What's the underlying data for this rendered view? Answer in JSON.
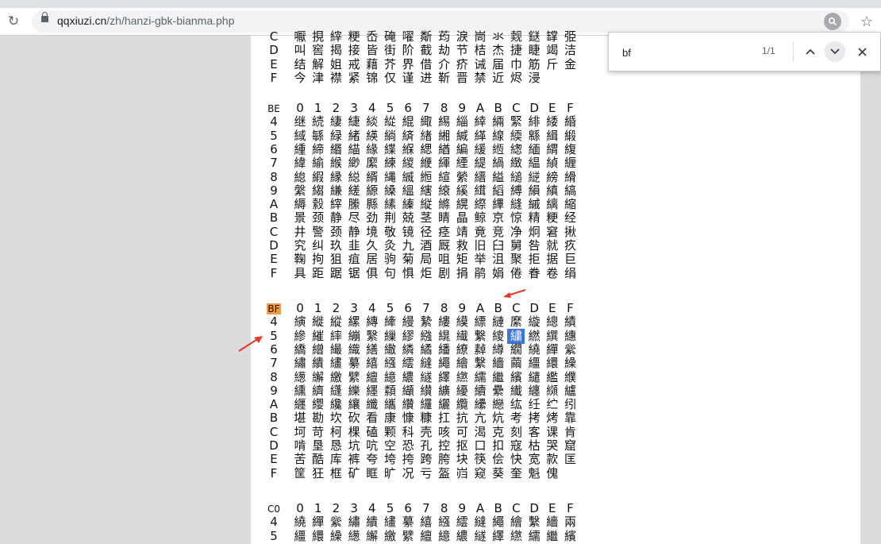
{
  "browser": {
    "url_host": "qqxiuzi.cn",
    "url_path": "/zh/hanzi-gbk-bianma.php",
    "back_glyph": "↻",
    "reload_icon": "reload-icon"
  },
  "find_bar": {
    "query": "bf",
    "count": "1/1"
  },
  "columns": [
    "0",
    "1",
    "2",
    "3",
    "4",
    "5",
    "6",
    "7",
    "8",
    "9",
    "A",
    "B",
    "C",
    "D",
    "E",
    "F"
  ],
  "sections": [
    {
      "id": "bd_tail",
      "rows": [
        {
          "label": "C",
          "chars": "嚈挸縡粳岙硽嚁斴荺淚峝氺觌鎹罉弫"
        },
        {
          "label": "D",
          "chars": "叫窖揭接皆街阶截劫节桔杰捷睫竭洁"
        },
        {
          "label": "E",
          "chars": "结解姐戒藉芥界借介疥诫届巾筋斤金"
        },
        {
          "label": "F",
          "chars": "今津襟紧锦仅谨进靳晋禁近烬浸"
        }
      ]
    },
    {
      "id": "be",
      "header": "BE",
      "rows": [
        {
          "label": "4",
          "chars": "继続緀緁緂緃緄緅緆緇緈緉緊緋緌緍"
        },
        {
          "label": "5",
          "chars": "緎緐緑緒緓緔緕緖緗緘緙線緛緜緝緞"
        },
        {
          "label": "6",
          "chars": "緟締緡緢緣緤緥緦緧編緩緪緫緬緭緮"
        },
        {
          "label": "7",
          "chars": "緯緰緱緲緳練緵緶緷緸緹緺緻緼緽緾"
        },
        {
          "label": "8",
          "chars": "緿縀縁縂縃縄縅縆縇縈縉縊縋縌縍縎"
        },
        {
          "label": "9",
          "chars": "縏縐縑縒縓縔縕縖縗縘縙縚縛縜縝縞"
        },
        {
          "label": "A",
          "chars": "縟縠縡縢縣縤縥縦縧縨縩縪縫縬縭縮"
        },
        {
          "label": "B",
          "chars": "景颈静尽劲荆兢茎睛晶鲸京惊精粳经"
        },
        {
          "label": "C",
          "chars": "井警颈静境敬镜径痉靖竟竞净炯窘揪"
        },
        {
          "label": "D",
          "chars": "究纠玖韭久灸九酒厩救旧臼舅咎就疚"
        },
        {
          "label": "E",
          "chars": "鞠拘狙疽居驹菊局咀矩举沮聚拒据巨"
        },
        {
          "label": "F",
          "chars": "具距踞锯俱句惧炬剧捐鹃娟倦眷卷绢"
        }
      ]
    },
    {
      "id": "bf",
      "header": "BF",
      "rows": [
        {
          "label": "4",
          "chars": "縯縰縱縲縳縴縵縶縷縸縹縺縻縼總績"
        },
        {
          "label": "5",
          "chars": "縿繀繂繃繄繅繆繈繉繊繋繌繍繎繏繐"
        },
        {
          "label": "6",
          "chars": "繑繒繓織繕繖繗繘繙繚繛繜繝繞繟繠"
        },
        {
          "label": "7",
          "chars": "繡繢繣繤繥繦繧繨繩繪繫繬繭繮繯繰"
        },
        {
          "label": "8",
          "chars": "繱繲繳繴繵繶繷繸繹繺繻繼繽繾繿纀"
        },
        {
          "label": "9",
          "chars": "纁纃纄纅纆纇纈纉纊纋續纍纎纏纐纑"
        },
        {
          "label": "A",
          "chars": "纒纓纔纕纖纗纘纙纚纜纝纞纮纴纻纼"
        },
        {
          "label": "B",
          "chars": "堪勘坎砍看康慷糠扛抗亢炕考拷烤靠"
        },
        {
          "label": "C",
          "chars": "坷苛柯棵磕颗科壳咳可渴克刻客课肯"
        },
        {
          "label": "D",
          "chars": "啃垦恳坑吭空恐孔控抠口扣寇枯哭窟"
        },
        {
          "label": "E",
          "chars": "苦酷库裤夸垮挎跨胯块筷侩快宽款匡"
        },
        {
          "label": "F",
          "chars": "筐狂框矿眶旷况亏盔岿窥葵奎魁傀"
        }
      ]
    },
    {
      "id": "c0",
      "header": "C0",
      "rows": [
        {
          "label": "4",
          "chars": "繞繟繠繡繢繣繤繥繦繧繨繩繪繫繬兩"
        },
        {
          "label": "5",
          "chars": "繮繯繰繱繲繳繴繵繶繷繸繹繺繻繼繽"
        }
      ]
    }
  ],
  "selected": {
    "section": "bf",
    "row": "5",
    "col": "C"
  },
  "colors": {
    "highlight": "#f39c41",
    "selection": "#3b77d9",
    "arrow": "#e8382c"
  }
}
